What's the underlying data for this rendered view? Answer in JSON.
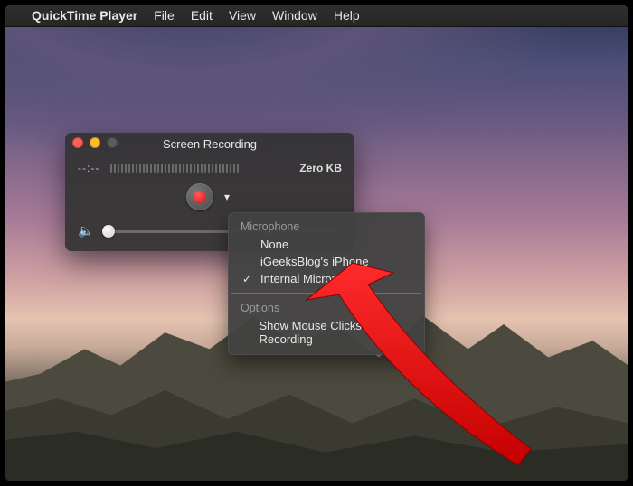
{
  "menubar": {
    "app_name": "QuickTime Player",
    "items": [
      "File",
      "Edit",
      "View",
      "Window",
      "Help"
    ]
  },
  "panel": {
    "title": "Screen Recording",
    "timecode": "--:--",
    "file_size": "Zero KB"
  },
  "dropdown": {
    "mic_header": "Microphone",
    "items": [
      {
        "label": "None",
        "checked": false
      },
      {
        "label": "iGeeksBlog's iPhone",
        "checked": false
      },
      {
        "label": "Internal Microphone",
        "checked": true
      }
    ],
    "options_header": "Options",
    "options": [
      {
        "label": "Show Mouse Clicks in Recording",
        "checked": false
      }
    ]
  }
}
